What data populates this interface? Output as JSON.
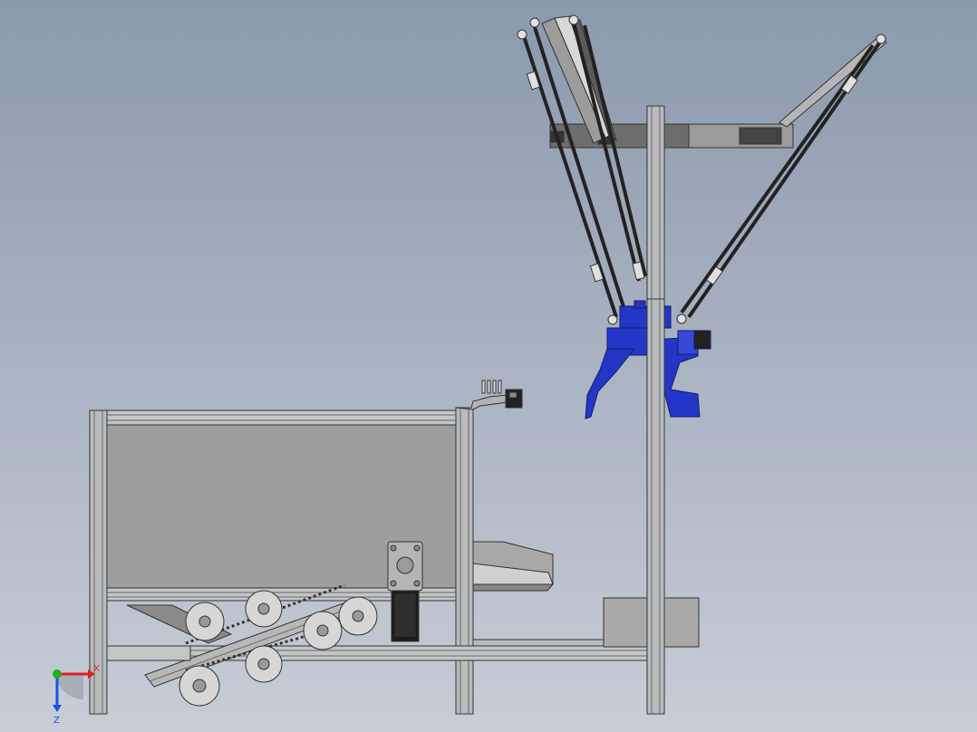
{
  "triad": {
    "x_label": "X",
    "z_label": "Z"
  },
  "colors": {
    "background_top": "#8a99ad",
    "background_bottom": "#c6ccd6",
    "frame": "#b9bcbf",
    "frame_edge": "#3a3a3a",
    "panel": "#9e9e9e",
    "robot_blue": "#2436c8",
    "dark": "#1c1c1c",
    "axis_x": "#e02020",
    "axis_y": "#20b020",
    "axis_z": "#2050e0"
  }
}
